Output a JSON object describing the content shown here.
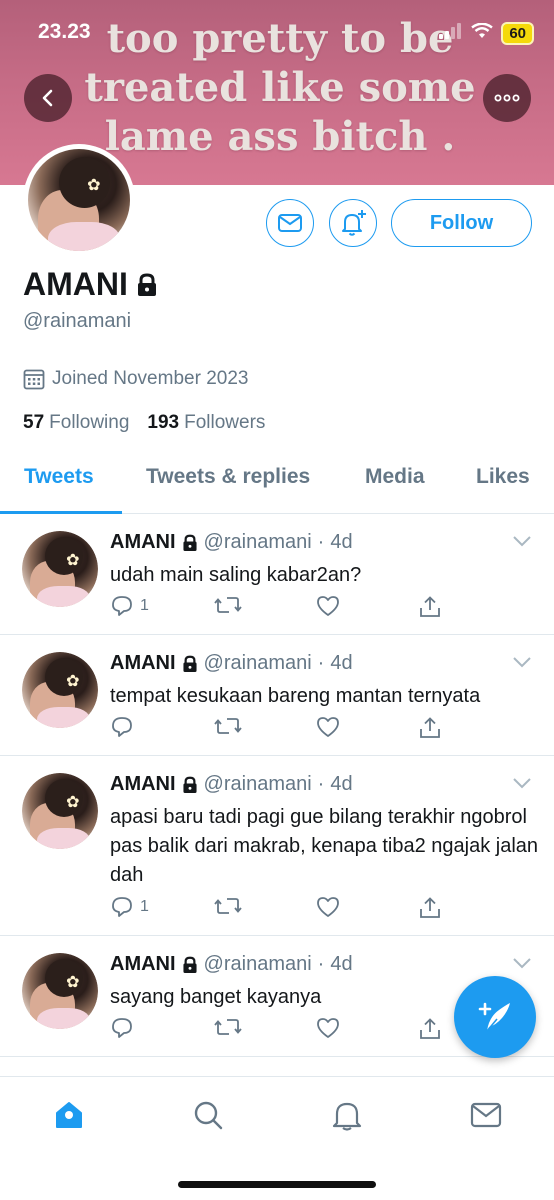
{
  "status_bar": {
    "time": "23.23",
    "battery": "60"
  },
  "banner": {
    "text": "too pretty to be\ntreated like some\nlame ass bitch ."
  },
  "profile": {
    "name": "AMANI",
    "handle": "@rainamani",
    "joined": "Joined November 2023",
    "following_count": "57",
    "following_label": "Following",
    "followers_count": "193",
    "followers_label": "Followers",
    "follow_button": "Follow"
  },
  "tabs": [
    "Tweets",
    "Tweets & replies",
    "Media",
    "Likes"
  ],
  "tweets": [
    {
      "name": "AMANI",
      "handle": "@rainamani",
      "time": "4d",
      "text": "udah main saling kabar2an?",
      "replies": "1"
    },
    {
      "name": "AMANI",
      "handle": "@rainamani",
      "time": "4d",
      "text": "tempat kesukaan bareng mantan ternyata",
      "replies": ""
    },
    {
      "name": "AMANI",
      "handle": "@rainamani",
      "time": "4d",
      "text": "apasi baru tadi pagi gue bilang terakhir ngobrol pas balik dari makrab, kenapa tiba2 ngajak jalan dah",
      "replies": "1"
    },
    {
      "name": "AMANI",
      "handle": "@rainamani",
      "time": "4d",
      "text": "sayang banget kayanya",
      "replies": ""
    }
  ],
  "icons": {
    "back": "chevron-left-icon",
    "more": "more-icon",
    "message": "envelope-icon",
    "notify": "bell-plus-icon",
    "lock": "lock-icon",
    "calendar": "calendar-icon",
    "compose": "compose-tweet-icon",
    "nav": [
      "home-icon",
      "search-icon",
      "notifications-icon",
      "messages-icon"
    ]
  },
  "colors": {
    "accent": "#1d9bf0",
    "secondary_text": "#657786",
    "banner": "#c66c86"
  }
}
